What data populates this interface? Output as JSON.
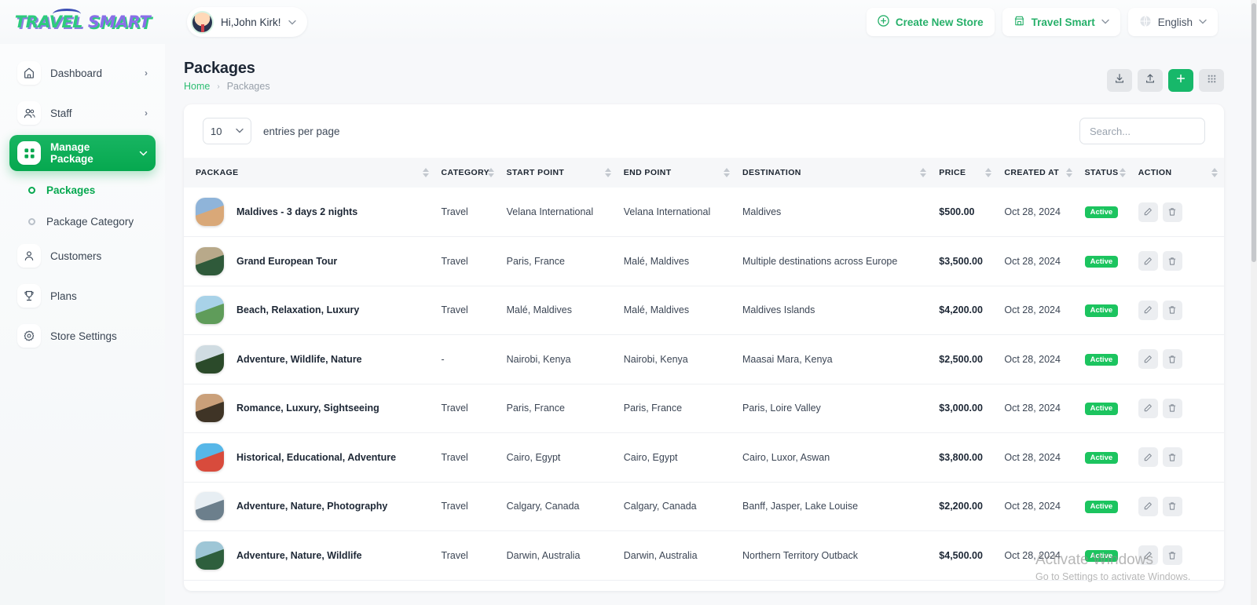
{
  "brand": {
    "word1": "TRAVEL",
    "word2": "SMART"
  },
  "topbar": {
    "user_greeting": "Hi,John Kirk!",
    "create_store_label": "Create New Store",
    "store_label": "Travel Smart",
    "language_label": "English",
    "chevron": "⌄"
  },
  "sidebar": {
    "items": [
      {
        "label": "Dashboard",
        "icon": "home-icon",
        "arrow": "›"
      },
      {
        "label": "Staff",
        "icon": "users-icon",
        "arrow": "›"
      },
      {
        "label": "Manage Package",
        "icon": "grid-icon",
        "arrow": "⌄"
      }
    ],
    "subitems": [
      {
        "label": "Packages"
      },
      {
        "label": "Package Category"
      }
    ],
    "items2": [
      {
        "label": "Customers",
        "icon": "user-icon"
      },
      {
        "label": "Plans",
        "icon": "trophy-icon"
      },
      {
        "label": "Store Settings",
        "icon": "gear-icon"
      }
    ]
  },
  "page": {
    "title": "Packages",
    "breadcrumb_home": "Home",
    "breadcrumb_sep": "›",
    "breadcrumb_current": "Packages",
    "actions": [
      {
        "name": "download-icon"
      },
      {
        "name": "upload-icon"
      },
      {
        "name": "plus-icon"
      },
      {
        "name": "grid-dots-icon"
      }
    ]
  },
  "toolbar": {
    "entries_value": "10",
    "entries_label": "entries per page",
    "search_placeholder": "Search...",
    "search_value": ""
  },
  "table": {
    "columns": [
      {
        "label": "PACKAGE",
        "sortable": true
      },
      {
        "label": "CATEGORY",
        "sortable": true
      },
      {
        "label": "START POINT",
        "sortable": true
      },
      {
        "label": "END POINT",
        "sortable": true
      },
      {
        "label": "DESTINATION",
        "sortable": true
      },
      {
        "label": "PRICE",
        "sortable": true
      },
      {
        "label": "CREATED AT",
        "sortable": true
      },
      {
        "label": "STATUS",
        "sortable": true
      },
      {
        "label": "ACTION",
        "sortable": true
      }
    ],
    "rows": [
      {
        "package": "Maldives - 3 days 2 nights",
        "category": "Travel",
        "start_point": "Velana International",
        "end_point": "Velana International",
        "destination": "Maldives",
        "price": "$500.00",
        "created_at": "Oct 28, 2024",
        "status": "Active",
        "thumb_colors": [
          "#8fb4d9",
          "#d9a878"
        ]
      },
      {
        "package": "Grand European Tour",
        "category": "Travel",
        "start_point": "Paris, France",
        "end_point": "Malé, Maldives",
        "destination": "Multiple destinations across Europe",
        "price": "$3,500.00",
        "created_at": "Oct 28, 2024",
        "status": "Active",
        "thumb_colors": [
          "#b8a98a",
          "#2f5a3a"
        ]
      },
      {
        "package": "Beach, Relaxation, Luxury",
        "category": "Travel",
        "start_point": "Malé, Maldives",
        "end_point": "Malé, Maldives",
        "destination": "Maldives Islands",
        "price": "$4,200.00",
        "created_at": "Oct 28, 2024",
        "status": "Active",
        "thumb_colors": [
          "#a8d2e8",
          "#5f9c5a"
        ]
      },
      {
        "package": "Adventure, Wildlife, Nature",
        "category": "-",
        "start_point": "Nairobi, Kenya",
        "end_point": "Nairobi, Kenya",
        "destination": "Maasai Mara, Kenya",
        "price": "$2,500.00",
        "created_at": "Oct 28, 2024",
        "status": "Active",
        "thumb_colors": [
          "#d0dce2",
          "#2b4a2a"
        ]
      },
      {
        "package": "Romance, Luxury, Sightseeing",
        "category": "Travel",
        "start_point": "Paris, France",
        "end_point": "Paris, France",
        "destination": "Paris, Loire Valley",
        "price": "$3,000.00",
        "created_at": "Oct 28, 2024",
        "status": "Active",
        "thumb_colors": [
          "#caa07a",
          "#3f3426"
        ]
      },
      {
        "package": "Historical, Educational, Adventure",
        "category": "Travel",
        "start_point": "Cairo, Egypt",
        "end_point": "Cairo, Egypt",
        "destination": "Cairo, Luxor, Aswan",
        "price": "$3,800.00",
        "created_at": "Oct 28, 2024",
        "status": "Active",
        "thumb_colors": [
          "#57b7e8",
          "#d84b3c"
        ]
      },
      {
        "package": "Adventure, Nature, Photography",
        "category": "Travel",
        "start_point": "Calgary, Canada",
        "end_point": "Calgary, Canada",
        "destination": "Banff, Jasper, Lake Louise",
        "price": "$2,200.00",
        "created_at": "Oct 28, 2024",
        "status": "Active",
        "thumb_colors": [
          "#e7eef3",
          "#6c7f8c"
        ]
      },
      {
        "package": "Adventure, Nature, Wildlife",
        "category": "Travel",
        "start_point": "Darwin, Australia",
        "end_point": "Darwin, Australia",
        "destination": "Northern Territory Outback",
        "price": "$4,500.00",
        "created_at": "Oct 28, 2024",
        "status": "Active",
        "thumb_colors": [
          "#9ec6d6",
          "#2e5f3d"
        ]
      }
    ]
  },
  "watermark": {
    "line1": "Activate Windows",
    "line2": "Go to Settings to activate Windows."
  },
  "colors": {
    "brand_green": "#06a84f",
    "accent_green": "#17b86a",
    "status_green": "#1cc45f",
    "brand_purple": "#8a6fe8"
  }
}
